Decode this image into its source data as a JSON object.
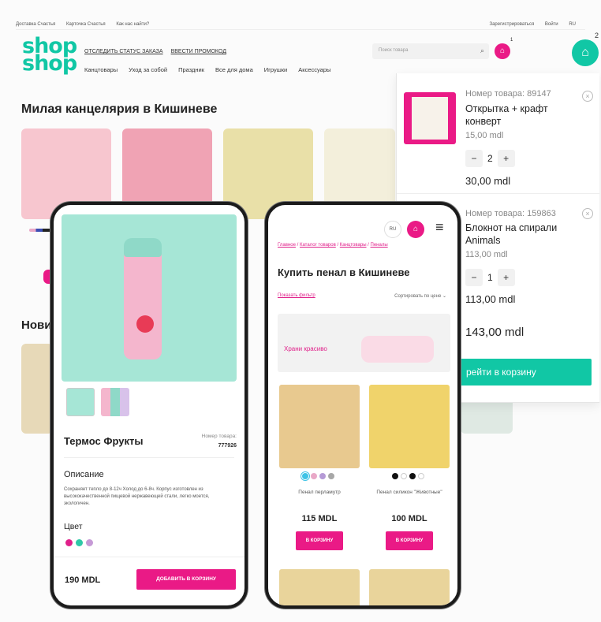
{
  "top_bar": {
    "links": [
      "Доставка Счастья",
      "Карточка Счастья",
      "Как нас найти?"
    ],
    "register": "Зарегистрироваться",
    "login": "Войти",
    "lang": "RU"
  },
  "logo": {
    "line1": "shop",
    "line2": "shop"
  },
  "header_links": [
    "ОТСЛЕДИТЬ СТАТУС ЗАКАЗА",
    "ВВЕСТИ ПРОМОКОД"
  ],
  "nav": [
    "Канцтовары",
    "Уход за собой",
    "Праздник",
    "Все для дома",
    "Игрушки",
    "Аксессуары"
  ],
  "search": {
    "placeholder": "Поиск товара"
  },
  "header_cart_count": "1",
  "section_title": "Милая канцелярия в Кишиневе",
  "section2_title": "Нови",
  "cart": {
    "count": "2",
    "items": [
      {
        "number": "Номер товара: 89147",
        "name": "Открытка + крафт конверт",
        "price": "15,00 mdl",
        "qty": "2",
        "total": "30,00 mdl"
      },
      {
        "number": "Номер товара: 159863",
        "name": "Блокнот на спирали Animals",
        "price": "113,00 mdl",
        "qty": "1",
        "total": "113,00 mdl"
      }
    ],
    "sum": "143,00 mdl",
    "go_label": "рейти в корзину"
  },
  "phone1": {
    "product_title": "Термос Фрукты",
    "number_label": "Номер товара:",
    "number": "777926",
    "desc_heading": "Описание",
    "desc_text": "Сохраняет тепло до 8-12ч Холод до 6-8ч. Корпус изготовлен из высококачественной пищевой нержавеющей стали, легко моется, экологичен.",
    "color_heading": "Цвет",
    "colors": [
      "#e0208a",
      "#2ec9a7",
      "#c69ad6"
    ],
    "price": "190 MDL",
    "add_label": "ДОБАВИТЬ В КОРЗИНУ"
  },
  "phone2": {
    "lang": "RU",
    "cart_count": "1",
    "breadcrumb": [
      "Главное",
      "Каталог товаров",
      "Канцтовары",
      "Пеналы"
    ],
    "title": "Купить пенал в Кишиневе",
    "filter_label": "Показать фильтр",
    "sort_label": "Сортировать по цене",
    "banner_text": "Храни красиво",
    "products": [
      {
        "name": "Пенал перламутр",
        "price": "115 MDL",
        "add_label": "В КОРЗИНУ",
        "colors": [
          "#3fc3e6",
          "#e9a8c7",
          "#b59ad6",
          "#a7a7a7"
        ]
      },
      {
        "name": "Пенал силикон \"Животные\"",
        "price": "100 MDL",
        "add_label": "В КОРЗИНУ",
        "colors": [
          "#111111",
          "#ffffff",
          "#111111",
          "#ffffff"
        ]
      }
    ]
  },
  "colors": {
    "brand_teal": "#11c7a5",
    "brand_pink": "#ea1a86"
  }
}
